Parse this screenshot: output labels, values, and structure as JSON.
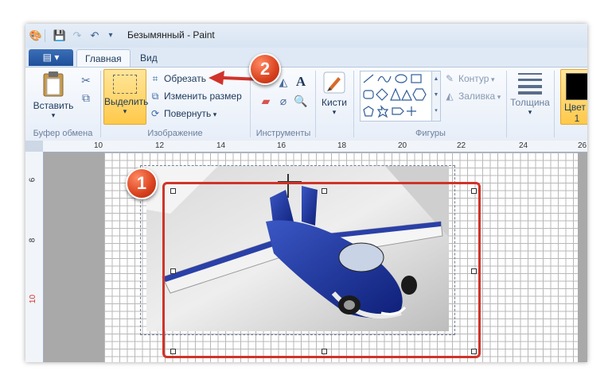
{
  "window": {
    "title": "Безымянный - Paint"
  },
  "quick_access": {
    "icons": [
      "paint-app-icon",
      "save-icon",
      "redo-icon",
      "undo-icon",
      "customize-dropdown-icon"
    ]
  },
  "tabs": {
    "file_label": "▤ ▾",
    "home": "Главная",
    "view": "Вид"
  },
  "ribbon": {
    "clipboard": {
      "paste": "Вставить",
      "group_label": "Буфер обмена"
    },
    "image": {
      "select": "Выделить",
      "crop": "Обрезать",
      "resize": "Изменить размер",
      "rotate": "Повернуть",
      "group_label": "Изображение"
    },
    "tools": {
      "group_label": "Инструменты",
      "text_tool": "A"
    },
    "brushes": {
      "label": "Кисти"
    },
    "shapes": {
      "outline": "Контур",
      "fill": "Заливка",
      "group_label": "Фигуры"
    },
    "size": {
      "label": "Толщина"
    },
    "color": {
      "label_line1": "Цвет",
      "label_line2": "1"
    }
  },
  "ruler": {
    "h_ticks": [
      "10",
      "12",
      "14",
      "16",
      "18",
      "20",
      "22",
      "24",
      "26"
    ],
    "v_ticks": [
      "6",
      "8",
      "10"
    ]
  },
  "annotations": {
    "badge1": "1",
    "badge2": "2"
  },
  "colors": {
    "accent_red": "#d0332a",
    "ribbon_bg": "#e7eef8",
    "canvas_bg": "#cdd7e5"
  }
}
